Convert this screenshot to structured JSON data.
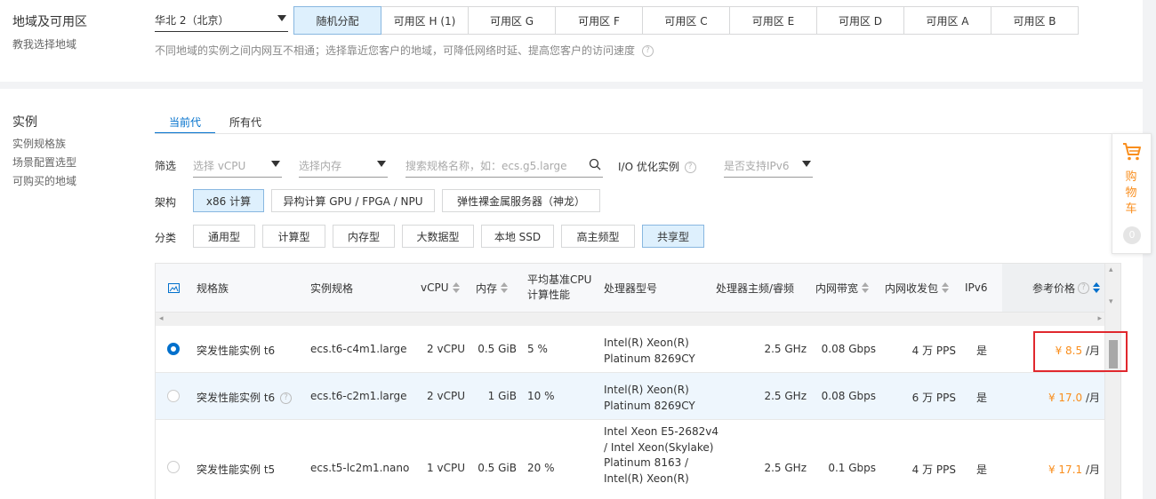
{
  "region": {
    "title": "地域及可用区",
    "help_link": "教我选择地域",
    "selected_region": "华北 2（北京）",
    "zones": [
      "随机分配",
      "可用区 H (1)",
      "可用区 G",
      "可用区 F",
      "可用区 C",
      "可用区 E",
      "可用区 D",
      "可用区 A",
      "可用区 B"
    ],
    "selected_zone_index": 0,
    "note": "不同地域的实例之间内网互不相通；选择靠近您客户的地域，可降低网络时延、提高您客户的访问速度"
  },
  "instance": {
    "title": "实例",
    "side_links": [
      "实例规格族",
      "场景配置选型",
      "可购买的地域"
    ],
    "tabs": [
      "当前代",
      "所有代"
    ],
    "filter": {
      "label": "筛选",
      "vcpu_placeholder": "选择 vCPU",
      "memory_placeholder": "选择内存",
      "search_placeholder": "搜索规格名称，如：ecs.g5.large",
      "io_label": "I/O 优化实例",
      "ipv6_placeholder": "是否支持IPv6"
    },
    "arch": {
      "label": "架构",
      "options": [
        "x86 计算",
        "异构计算 GPU / FPGA / NPU",
        "弹性裸金属服务器（神龙）"
      ],
      "selected_index": 0
    },
    "category": {
      "label": "分类",
      "options": [
        "通用型",
        "计算型",
        "内存型",
        "大数据型",
        "本地 SSD",
        "高主频型",
        "共享型"
      ],
      "selected_index": 6
    },
    "table": {
      "headers": {
        "family": "规格族",
        "spec": "实例规格",
        "vcpu": "vCPU",
        "memory": "内存",
        "baseline_1": "平均基准CPU",
        "baseline_2": "计算性能",
        "processor": "处理器型号",
        "freq": "处理器主频/睿频",
        "bandwidth": "内网带宽",
        "pps": "内网收发包",
        "ipv6": "IPv6",
        "price": "参考价格"
      },
      "rows": [
        {
          "family": "突发性能实例 t6",
          "spec": "ecs.t6-c4m1.large",
          "vcpu": "2 vCPU",
          "memory": "0.5 GiB",
          "baseline": "5 %",
          "proc_1": "Intel(R) Xeon(R)",
          "proc_2": "Platinum 8269CY",
          "proc_3": "",
          "proc_4": "",
          "freq": "2.5 GHz",
          "bandwidth": "0.08 Gbps",
          "pps": "4 万 PPS",
          "ipv6": "是",
          "price": "¥ 8.5",
          "unit": " /月"
        },
        {
          "family": "突发性能实例 t6",
          "spec": "ecs.t6-c2m1.large",
          "vcpu": "2 vCPU",
          "memory": "1 GiB",
          "baseline": "10 %",
          "proc_1": "Intel(R) Xeon(R)",
          "proc_2": "Platinum 8269CY",
          "proc_3": "",
          "proc_4": "",
          "freq": "2.5 GHz",
          "bandwidth": "0.08 Gbps",
          "pps": "6 万 PPS",
          "ipv6": "是",
          "price": "¥ 17.0",
          "unit": " /月"
        },
        {
          "family": "突发性能实例 t5",
          "spec": "ecs.t5-lc2m1.nano",
          "vcpu": "1 vCPU",
          "memory": "0.5 GiB",
          "baseline": "20 %",
          "proc_1": "Intel Xeon E5-2682v4",
          "proc_2": "/ Intel Xeon(Skylake)",
          "proc_3": "Platinum 8163 /",
          "proc_4": "Intel(R) Xeon(R)",
          "freq": "2.5 GHz",
          "bandwidth": "0.1 Gbps",
          "pps": "4 万 PPS",
          "ipv6": "是",
          "price": "¥ 17.1",
          "unit": " /月"
        }
      ]
    }
  },
  "cart": {
    "label_1": "购",
    "label_2": "物",
    "label_3": "车",
    "count": "0"
  },
  "colors": {
    "accent": "#0070cc",
    "price": "#f98e1d",
    "highlight": "#e0282e"
  }
}
